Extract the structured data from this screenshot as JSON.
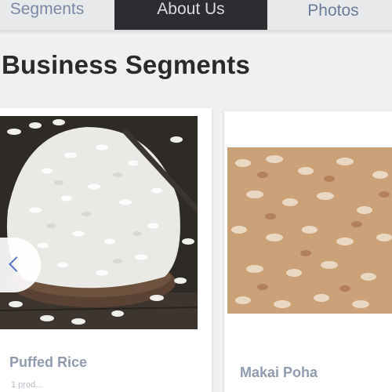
{
  "nav": {
    "tabs": [
      {
        "label": "Segments"
      },
      {
        "label": "About Us"
      },
      {
        "label": "Photos"
      }
    ]
  },
  "section": {
    "title": "Business Segments"
  },
  "cards": [
    {
      "label": "Puffed Rice",
      "sub": "1 prod..."
    },
    {
      "label": "Makai Poha"
    }
  ],
  "colors": {
    "active_tab_bg": "#2b2d31",
    "tab_text": "#6b7c99",
    "card_label": "#8f9bad",
    "arrow": "#5575c4"
  },
  "icons": {
    "carousel_prev": "chevron-left-icon"
  }
}
